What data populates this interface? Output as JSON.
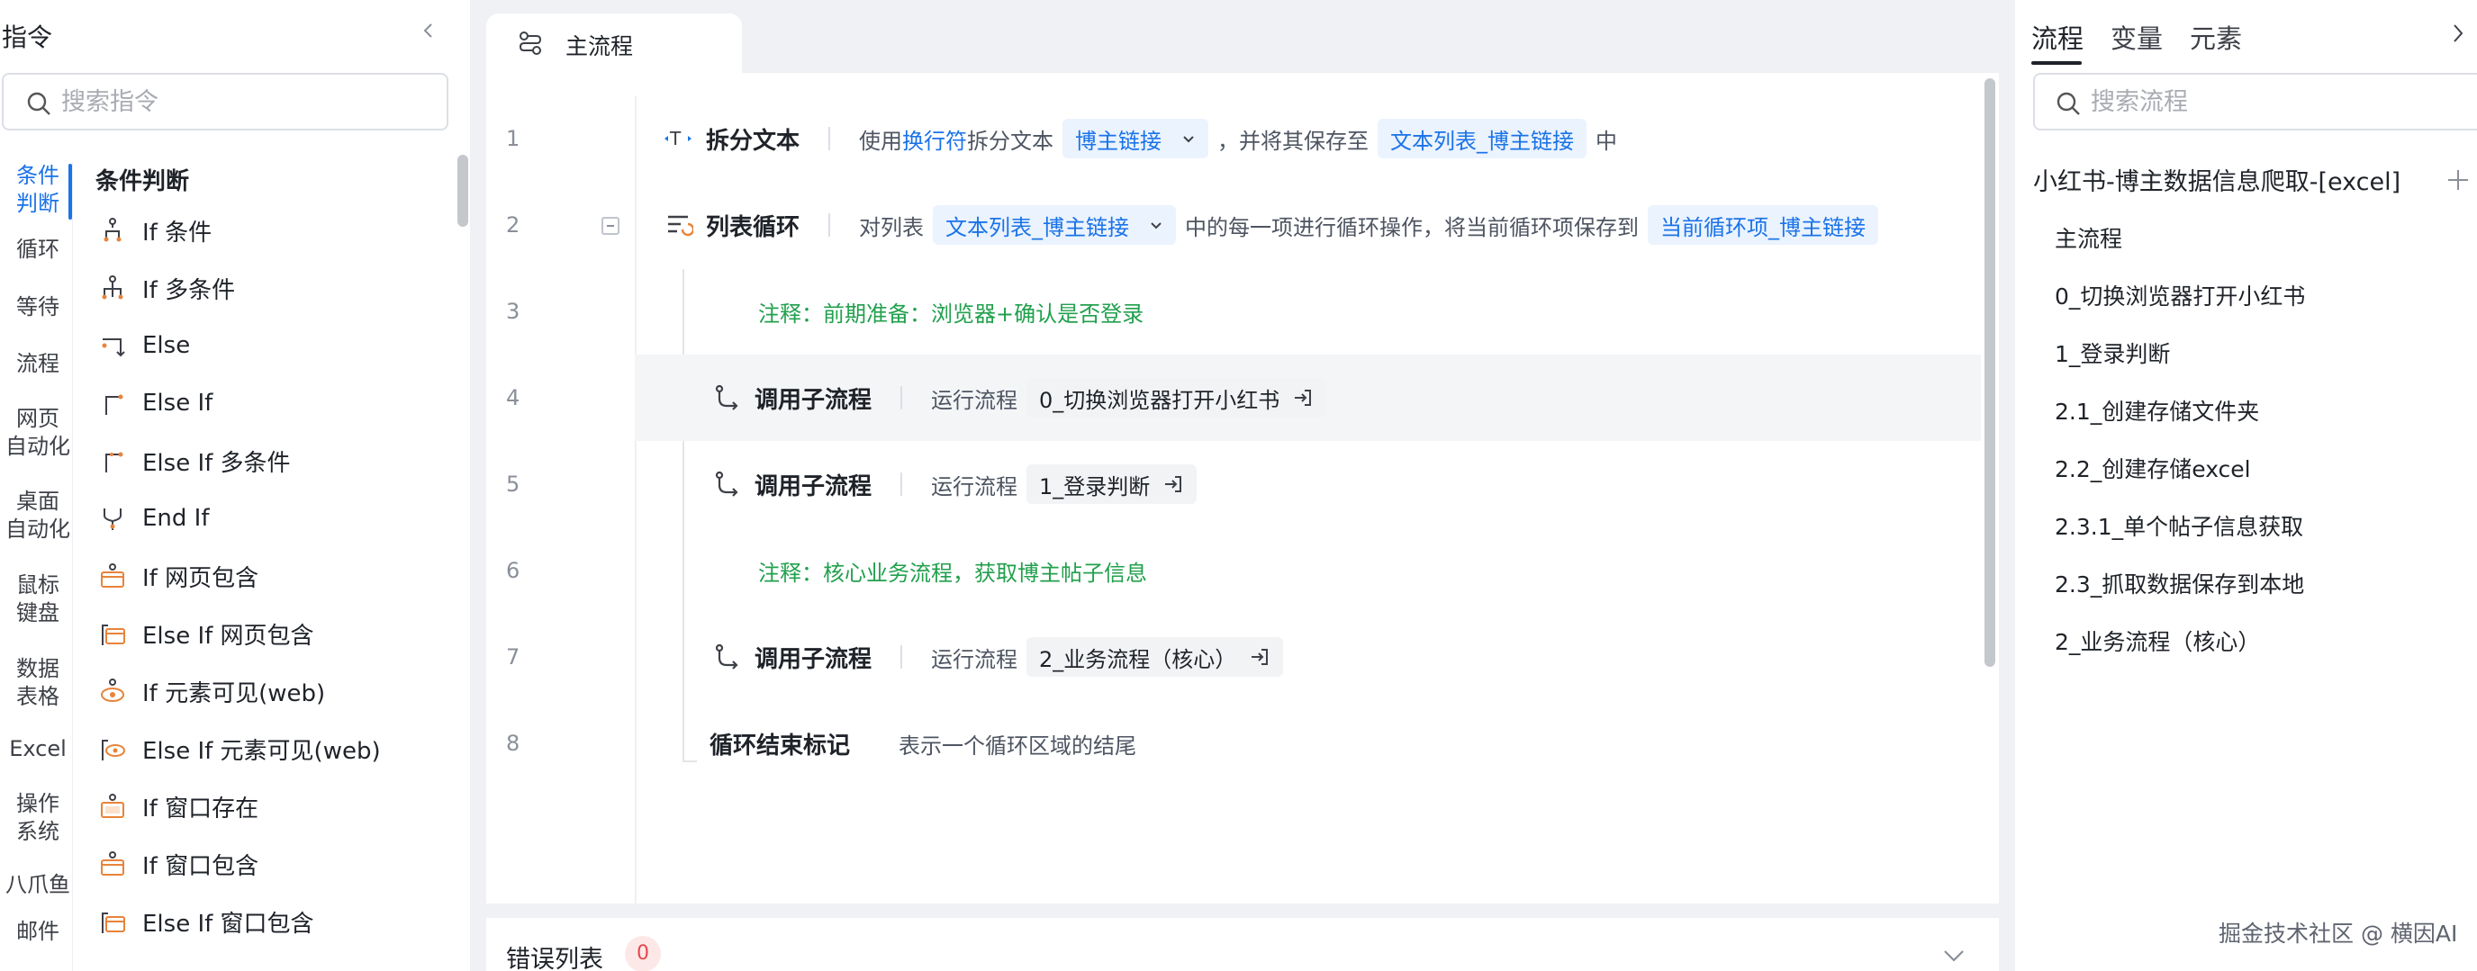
{
  "left": {
    "title": "指令",
    "search_placeholder": "搜索指令",
    "categories": [
      "条件\n判断",
      "循环",
      "等待",
      "流程",
      "网页\n自动化",
      "桌面\n自动化",
      "鼠标\n键盘",
      "数据\n表格",
      "Excel",
      "操作\n系统",
      "八爪鱼",
      "邮件"
    ],
    "group_title": "条件判断",
    "commands": [
      "If 条件",
      "If 多条件",
      "Else",
      "Else If",
      "Else If 多条件",
      "End If",
      "If 网页包含",
      "Else If 网页包含",
      "If 元素可见(web)",
      "Else If 元素可见(web)",
      "If 窗口存在",
      "If 窗口包含",
      "Else If 窗口包含"
    ]
  },
  "tab": {
    "label": "主流程"
  },
  "editor": {
    "rows": [
      {
        "n": "1",
        "kw": "拆分文本",
        "t1": "使用",
        "t1b": "换行符",
        "t2": "拆分文本",
        "p1": "博主链接",
        "t3": "，并将其保存至",
        "p2": "文本列表_博主链接",
        "t4": "中"
      },
      {
        "n": "2",
        "kw": "列表循环",
        "t1": "对列表",
        "p1": "文本列表_博主链接",
        "t2": "中的每一项进行循环操作，将当前循环项保存到",
        "p2": "当前循环项_博主链接"
      },
      {
        "n": "3",
        "comment": "注释：前期准备：浏览器+确认是否登录"
      },
      {
        "n": "4",
        "kw": "调用子流程",
        "t1": "运行流程",
        "p1": "0_切换浏览器打开小红书"
      },
      {
        "n": "5",
        "kw": "调用子流程",
        "t1": "运行流程",
        "p1": "1_登录判断"
      },
      {
        "n": "6",
        "comment": "注释：核心业务流程，获取博主帖子信息"
      },
      {
        "n": "7",
        "kw": "调用子流程",
        "t1": "运行流程",
        "p1": "2_业务流程（核心）"
      },
      {
        "n": "8",
        "kw": "循环结束标记",
        "t1": "表示一个循环区域的结尾"
      }
    ]
  },
  "errors": {
    "label": "错误列表",
    "count": "0"
  },
  "right": {
    "tabs": [
      "流程",
      "变量",
      "元素"
    ],
    "search_placeholder": "搜索流程",
    "project": "小红书-博主数据信息爬取-[excel]",
    "flows": [
      "主流程",
      "0_切换浏览器打开小红书",
      "1_登录判断",
      "2.1_创建存储文件夹",
      "2.2_创建存储excel",
      "2.3.1_单个帖子信息获取",
      "2.3_抓取数据保存到本地",
      "2_业务流程（核心）"
    ]
  },
  "watermark": "掘金技术社区 @ 横因AI",
  "colors": {
    "accent": "#1a73e8",
    "comment": "#21a04d",
    "pill_bg": "#ebf3fe",
    "error": "#e5484d"
  }
}
